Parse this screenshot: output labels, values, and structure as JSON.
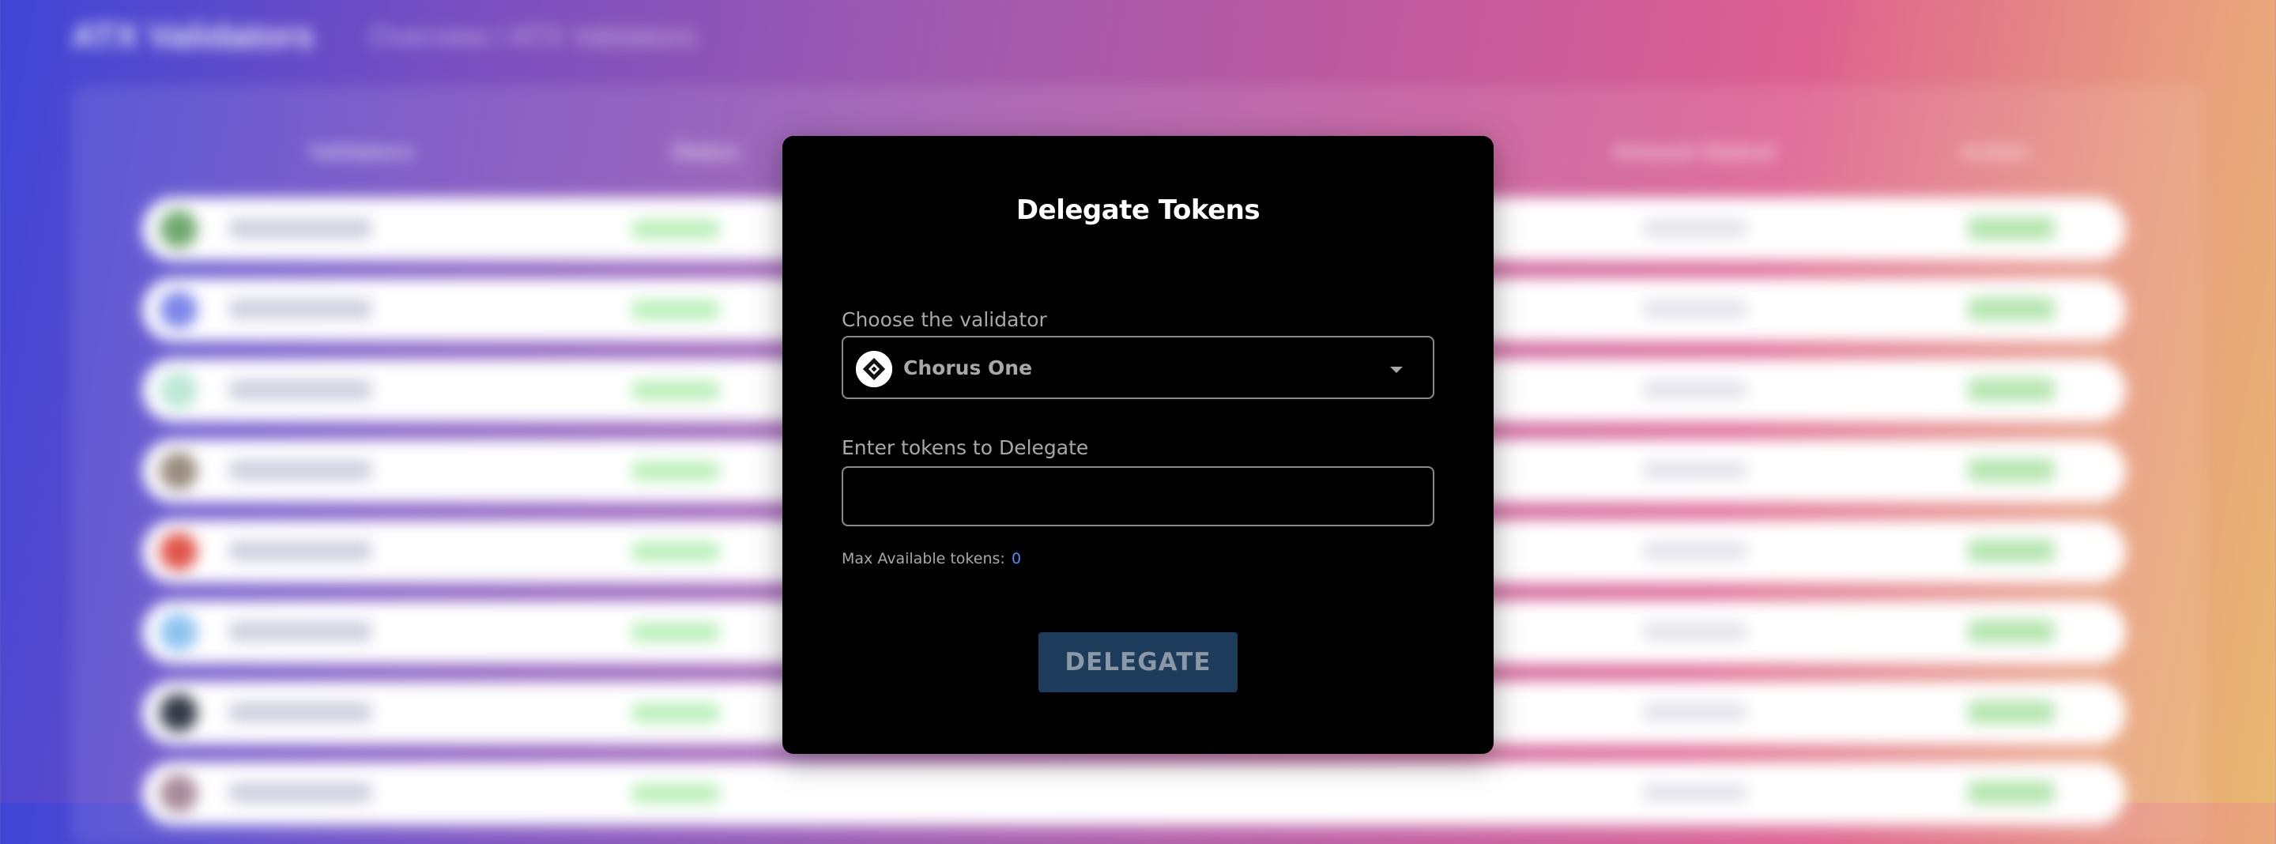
{
  "background": {
    "app_title": "ATX Validators",
    "breadcrumb": "Overview / ATX Validators",
    "column_headers": [
      "Validators",
      "Status",
      "Amount Staked",
      "Action"
    ],
    "row_avatar_colors": [
      "#6fa96f",
      "#7d86e8",
      "#bde8d8",
      "#9a8c80",
      "#e0554a",
      "#8fc3f0",
      "#333a48",
      "#a88a9a"
    ]
  },
  "modal": {
    "title": "Delegate Tokens",
    "validator_label": "Choose the validator",
    "selected_validator": "Chorus One",
    "validator_icon": "chorus-one-logo",
    "tokens_label": "Enter tokens to Delegate",
    "tokens_value": "",
    "tokens_placeholder": "",
    "max_available_label": "Max Available tokens:",
    "max_available_value": "0",
    "delegate_button": "DELEGATE"
  },
  "colors": {
    "modal_background": "#000000",
    "button_background": "#1d3b5a",
    "accent_blue": "#4e8df5"
  }
}
